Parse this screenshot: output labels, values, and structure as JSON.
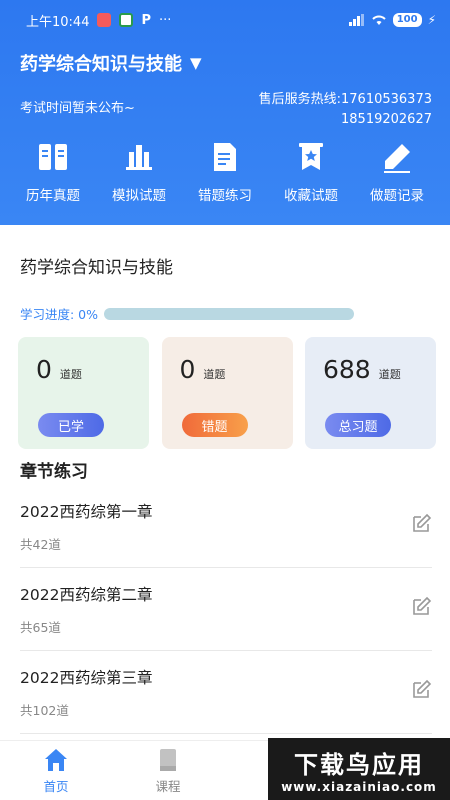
{
  "status": {
    "time": "上午10:44",
    "battery": "100",
    "dots": "···"
  },
  "header": {
    "subject": "药学综合知识与技能",
    "dropdown_glyph": "▼",
    "exam_time": "考试时间暂未公布~",
    "hotline_label": "售后服务热线:",
    "hotline_1": "17610536373",
    "hotline_2": "18519202627"
  },
  "shortcuts": [
    {
      "label": "历年真题",
      "icon": "book-open-icon"
    },
    {
      "label": "模拟试题",
      "icon": "building-icon"
    },
    {
      "label": "错题练习",
      "icon": "document-icon"
    },
    {
      "label": "收藏试题",
      "icon": "bookmark-star-icon"
    },
    {
      "label": "做题记录",
      "icon": "pencil-icon"
    }
  ],
  "course": {
    "title": "药学综合知识与技能",
    "progress_label": "学习进度: 0%",
    "progress_value": 0
  },
  "stats": [
    {
      "value": "0",
      "unit": "道题",
      "tag": "已学"
    },
    {
      "value": "0",
      "unit": "道题",
      "tag": "错题"
    },
    {
      "value": "688",
      "unit": "道题",
      "tag": "总习题"
    }
  ],
  "section": {
    "title": "章节练习"
  },
  "chapters": [
    {
      "name": "2022西药综第一章",
      "count": "共42道"
    },
    {
      "name": "2022西药综第二章",
      "count": "共65道"
    },
    {
      "name": "2022西药综第三章",
      "count": "共102道"
    }
  ],
  "nav": [
    {
      "label": "首页",
      "icon": "home-icon",
      "active": true
    },
    {
      "label": "课程",
      "icon": "course-book-icon",
      "active": false
    }
  ],
  "watermark": {
    "main": "下载鸟应用",
    "sub": "www.xiazainiao.com"
  },
  "colors": {
    "primary": "#3a86f4",
    "header_top": "#2d78f0"
  }
}
